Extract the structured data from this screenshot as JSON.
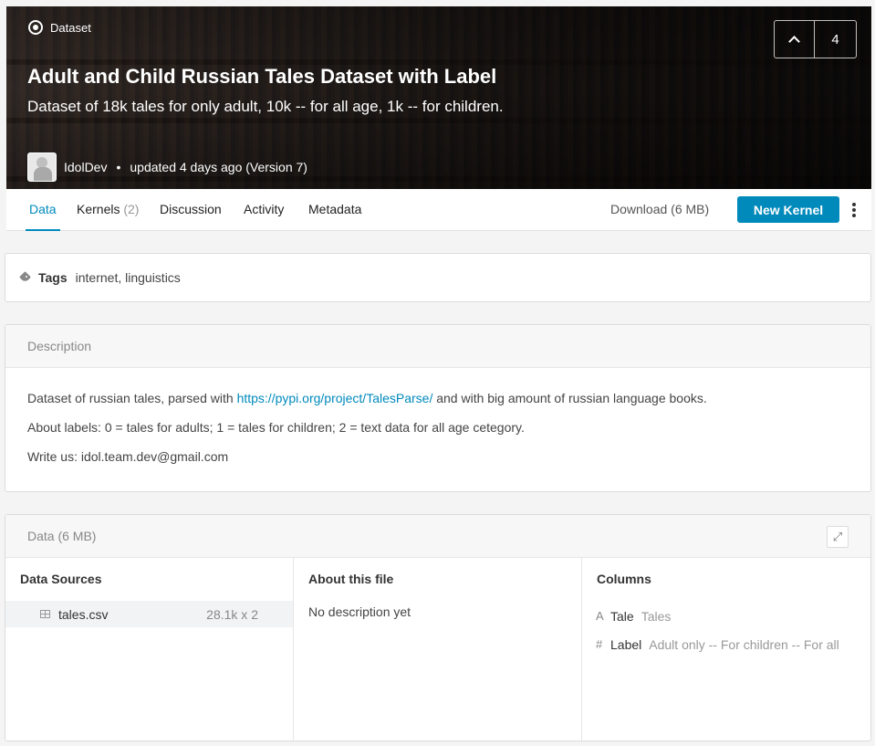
{
  "hero": {
    "type_label": "Dataset",
    "title": "Adult and Child Russian Tales Dataset with Label",
    "subtitle": "Dataset of 18k tales for only adult, 10k -- for all age, 1k -- for children.",
    "owner": "IdolDev",
    "updated": "updated 4 days ago (Version 7)",
    "vote_count": "4"
  },
  "tabs": [
    {
      "label": "Data",
      "count": ""
    },
    {
      "label": "Kernels",
      "count": "(2)"
    },
    {
      "label": "Discussion",
      "count": ""
    },
    {
      "label": "Activity",
      "count": ""
    },
    {
      "label": "Metadata",
      "count": ""
    }
  ],
  "toolbar": {
    "download_label": "Download (6 MB)",
    "new_kernel_label": "New Kernel"
  },
  "tags": {
    "label": "Tags",
    "values": "internet, linguistics"
  },
  "description": {
    "header": "Description",
    "line1_prefix": "Dataset of russian tales, parsed with ",
    "line1_link": "https://pypi.org/project/TalesParse/",
    "line1_suffix": " and with big amount of russian language books.",
    "line2": "About labels: 0 = tales for adults; 1 = tales for children; 2 = text data for all age cetegory.",
    "line3": "Write us: idol.team.dev@gmail.com"
  },
  "data_section": {
    "header": "Data (6 MB)",
    "sources_title": "Data Sources",
    "file_name": "tales.csv",
    "file_size": "28.1k x 2",
    "about_title": "About this file",
    "about_text": "No description yet",
    "columns_title": "Columns",
    "columns": [
      {
        "type_icon": "A",
        "name": "Tale",
        "desc": "Tales"
      },
      {
        "type_icon": "#",
        "name": "Label",
        "desc": "Adult only -- For children -- For all"
      }
    ]
  }
}
